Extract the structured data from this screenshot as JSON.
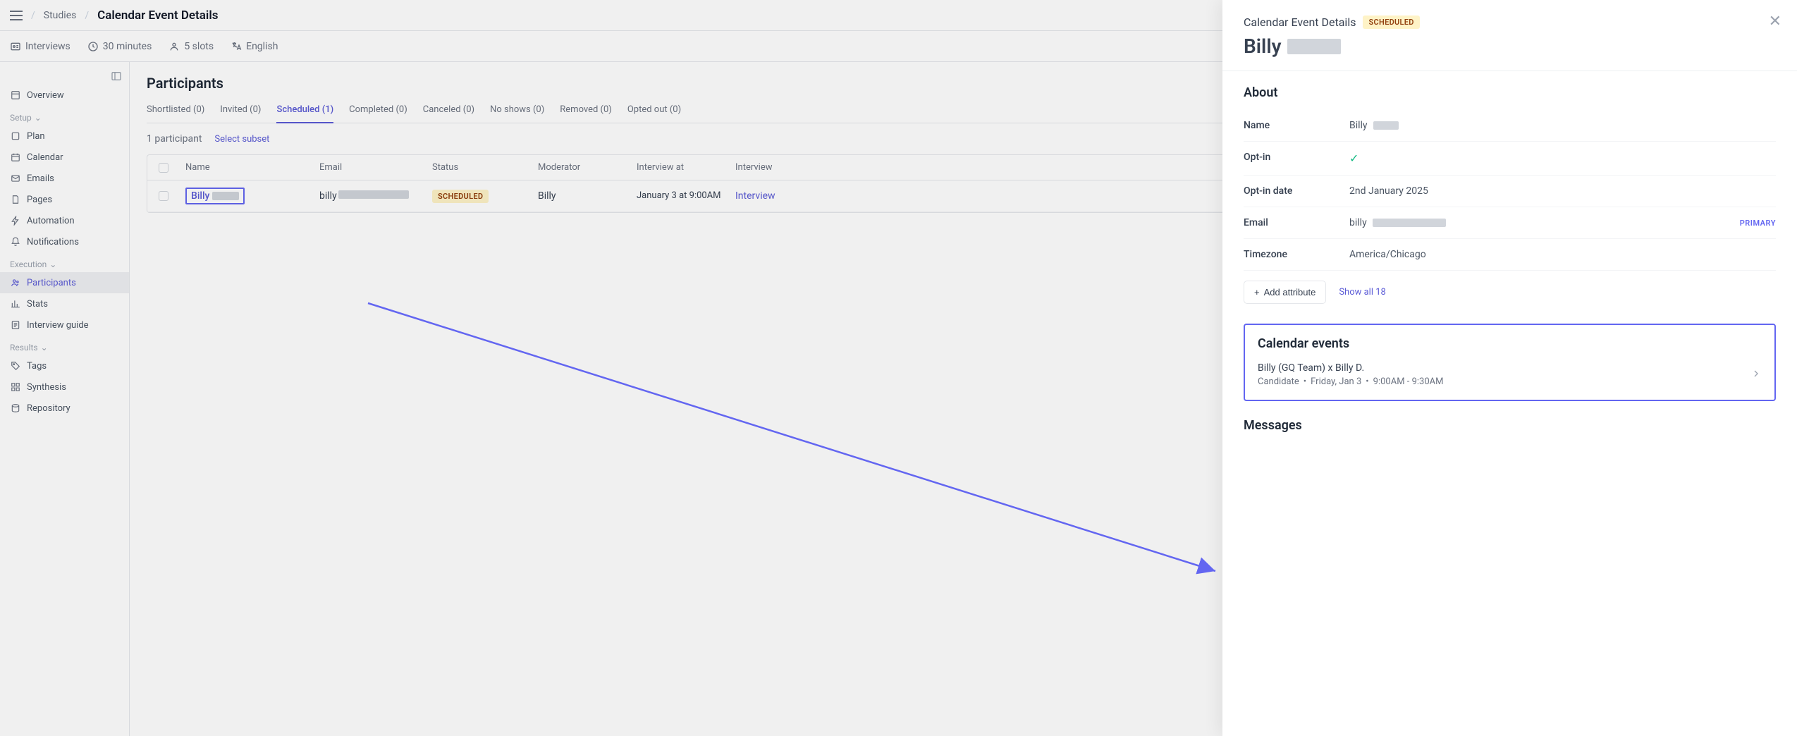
{
  "breadcrumb": {
    "parent": "Studies",
    "current": "Calendar Event Details"
  },
  "secondbar": {
    "interviews": "Interviews",
    "duration": "30 minutes",
    "slots": "5 slots",
    "language": "English"
  },
  "sidebar": {
    "overview": "Overview",
    "setup_label": "Setup",
    "plan": "Plan",
    "calendar": "Calendar",
    "emails": "Emails",
    "pages": "Pages",
    "automation": "Automation",
    "notifications": "Notifications",
    "execution_label": "Execution",
    "participants": "Participants",
    "stats": "Stats",
    "interview_guide": "Interview guide",
    "results_label": "Results",
    "tags": "Tags",
    "synthesis": "Synthesis",
    "repository": "Repository"
  },
  "main": {
    "heading": "Participants",
    "tabs": {
      "shortlisted": "Shortlisted (0)",
      "invited": "Invited (0)",
      "scheduled": "Scheduled (1)",
      "completed": "Completed (0)",
      "canceled": "Canceled (0)",
      "no_shows": "No shows (0)",
      "removed": "Removed (0)",
      "opted_out": "Opted out (0)"
    },
    "count": "1 participant",
    "select_subset": "Select subset",
    "columns": {
      "name": "Name",
      "email": "Email",
      "status": "Status",
      "moderator": "Moderator",
      "interview_at": "Interview at",
      "interview": "Interview"
    },
    "row": {
      "name": "Billy",
      "email": "billy",
      "status": "SCHEDULED",
      "moderator": "Billy",
      "interview_at": "January 3 at 9:00AM",
      "interview_link": "Interview"
    }
  },
  "drawer": {
    "title": "Calendar Event Details",
    "status": "SCHEDULED",
    "name_first": "Billy",
    "about_heading": "About",
    "attrs": {
      "name_label": "Name",
      "name_value": "Billy",
      "optin_label": "Opt-in",
      "optin_date_label": "Opt-in date",
      "optin_date_value": "2nd January 2025",
      "email_label": "Email",
      "email_value": "billy",
      "email_primary": "PRIMARY",
      "timezone_label": "Timezone",
      "timezone_value": "America/Chicago"
    },
    "add_attribute": "Add attribute",
    "show_all": "Show all 18",
    "cal_events_heading": "Calendar events",
    "cal_event": {
      "title": "Billy (GQ Team) x Billy D.",
      "role": "Candidate",
      "date": "Friday, Jan 3",
      "time": "9:00AM - 9:30AM"
    },
    "messages_heading": "Messages"
  }
}
